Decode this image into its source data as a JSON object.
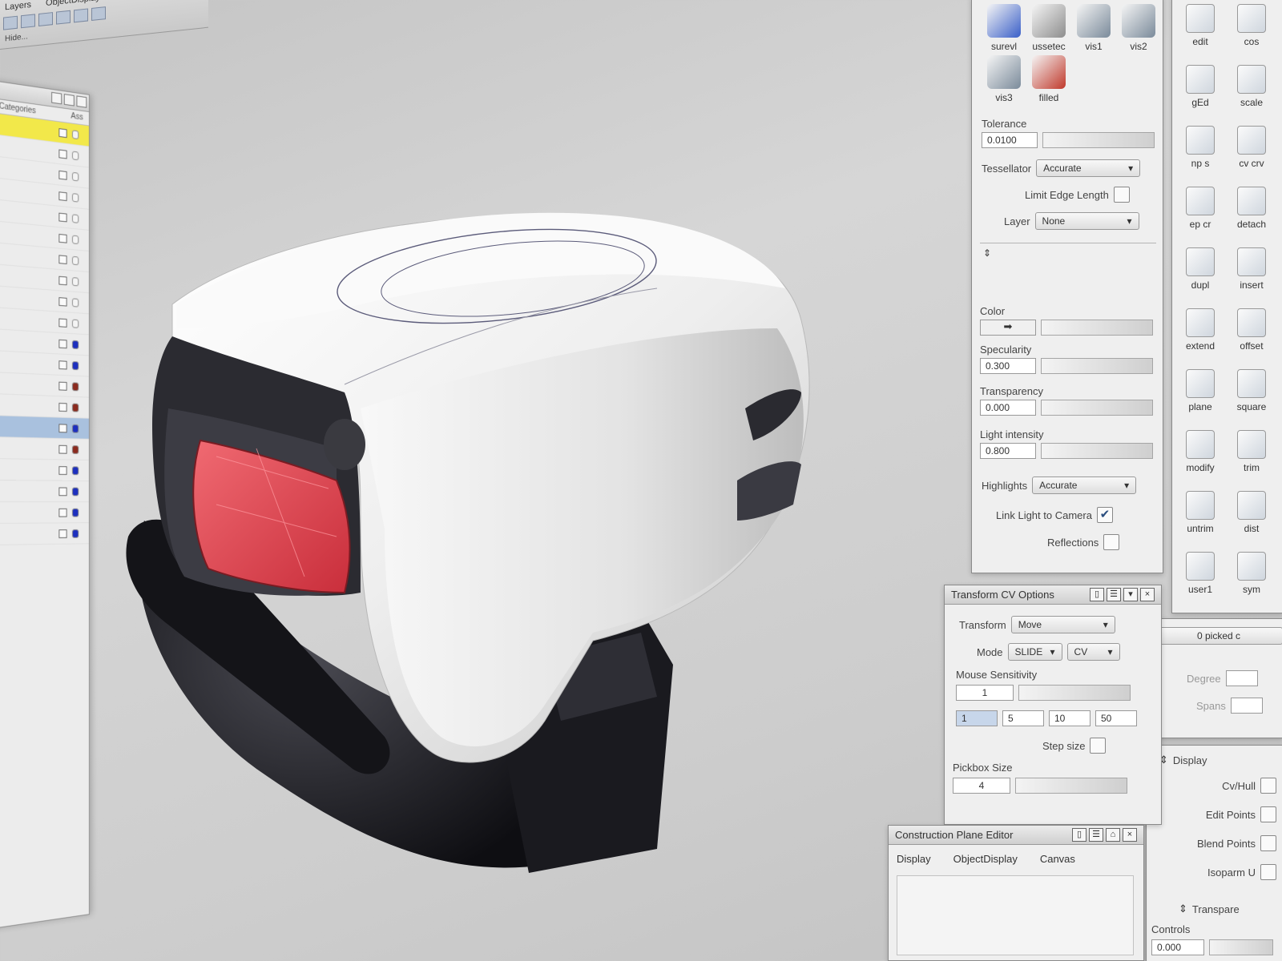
{
  "top_toolbar": {
    "menus": [
      "Layers",
      "ObjectDisplay"
    ],
    "status": "Hide..."
  },
  "layers": {
    "header_left": "Categories",
    "header_right": "Ass",
    "rows": [
      {
        "state": "highlight",
        "color": "#f4f4f4"
      },
      {
        "state": "",
        "color": "#f4f4f4"
      },
      {
        "state": "",
        "color": "#f4f4f4"
      },
      {
        "state": "",
        "color": "#f4f4f4"
      },
      {
        "state": "",
        "color": "#f4f4f4"
      },
      {
        "state": "",
        "color": "#f4f4f4"
      },
      {
        "state": "",
        "color": "#f4f4f4"
      },
      {
        "state": "",
        "color": "#f4f4f4"
      },
      {
        "state": "",
        "color": "#f4f4f4"
      },
      {
        "state": "",
        "color": "#f4f4f4"
      },
      {
        "state": "",
        "color": "#1c2fbf"
      },
      {
        "state": "",
        "color": "#1c2fbf"
      },
      {
        "state": "",
        "color": "#8b2a1e"
      },
      {
        "state": "",
        "color": "#8b2a1e"
      },
      {
        "state": "selected",
        "color": "#1c2fbf"
      },
      {
        "state": "",
        "color": "#8b2a1e"
      },
      {
        "state": "",
        "color": "#1c2fbf"
      },
      {
        "state": "",
        "color": "#1c2fbf"
      },
      {
        "state": "",
        "color": "#1c2fbf"
      },
      {
        "state": "",
        "color": "#1c2fbf"
      }
    ]
  },
  "shelf": {
    "icons": [
      {
        "label": "surevl",
        "color": "#3a5fc8"
      },
      {
        "label": "ussetec",
        "color": "#8d8d8d"
      },
      {
        "label": "vis1",
        "color": "#7a8a9a"
      },
      {
        "label": "vis2",
        "color": "#7a8a9a"
      },
      {
        "label": "vis3",
        "color": "#7a8a9a"
      },
      {
        "label": "filled",
        "color": "#c0392b"
      }
    ]
  },
  "tessellation": {
    "tolerance_label": "Tolerance",
    "tolerance_value": "0.0100",
    "tessellator_label": "Tessellator",
    "tessellator_value": "Accurate",
    "limit_edge_label": "Limit Edge Length",
    "layer_label": "Layer",
    "layer_value": "None"
  },
  "shading": {
    "color_label": "Color",
    "specularity_label": "Specularity",
    "specularity_value": "0.300",
    "transparency_label": "Transparency",
    "transparency_value": "0.000",
    "light_label": "Light intensity",
    "light_value": "0.800",
    "highlights_label": "Highlights",
    "highlights_value": "Accurate",
    "link_light_label": "Link Light to Camera",
    "link_light_checked": "✔",
    "reflections_label": "Reflections"
  },
  "palette": {
    "icons": [
      "edit",
      "cos",
      "gEd",
      "scale",
      "np s",
      "cv crv",
      "ep cr",
      "detach",
      "dupl",
      "insert",
      "extend",
      "offset",
      "plane",
      "square",
      "modify",
      "trim",
      "untrim",
      "dist",
      "user1",
      "sym"
    ]
  },
  "transform_cv": {
    "title": "Transform CV Options",
    "transform_label": "Transform",
    "transform_value": "Move",
    "mode_label": "Mode",
    "mode_value": "SLIDE",
    "mode_value2": "CV",
    "sensitivity_label": "Mouse Sensitivity",
    "sensitivity_value": "1",
    "steps": [
      "1",
      "5",
      "10",
      "50"
    ],
    "step_size_label": "Step size",
    "pickbox_label": "Pickbox Size",
    "pickbox_value": "4"
  },
  "construction_plane": {
    "title": "Construction Plane Editor",
    "tabs": [
      "Display",
      "ObjectDisplay",
      "Canvas"
    ]
  },
  "info_panel": {
    "picked": "0 picked c",
    "degree_label": "Degree",
    "spans_label": "Spans"
  },
  "display_panel": {
    "title": "Display",
    "items": [
      "Cv/Hull",
      "Edit Points",
      "Blend Points",
      "Isoparm U"
    ],
    "transparency_title": "Transpare",
    "controls_label": "Controls",
    "controls_value": "0.000"
  },
  "colors": {
    "tail_light": "#e24a55",
    "body": "#f4f4f4",
    "accent_selection": "#a9c1de",
    "highlight": "#f2e84a"
  }
}
